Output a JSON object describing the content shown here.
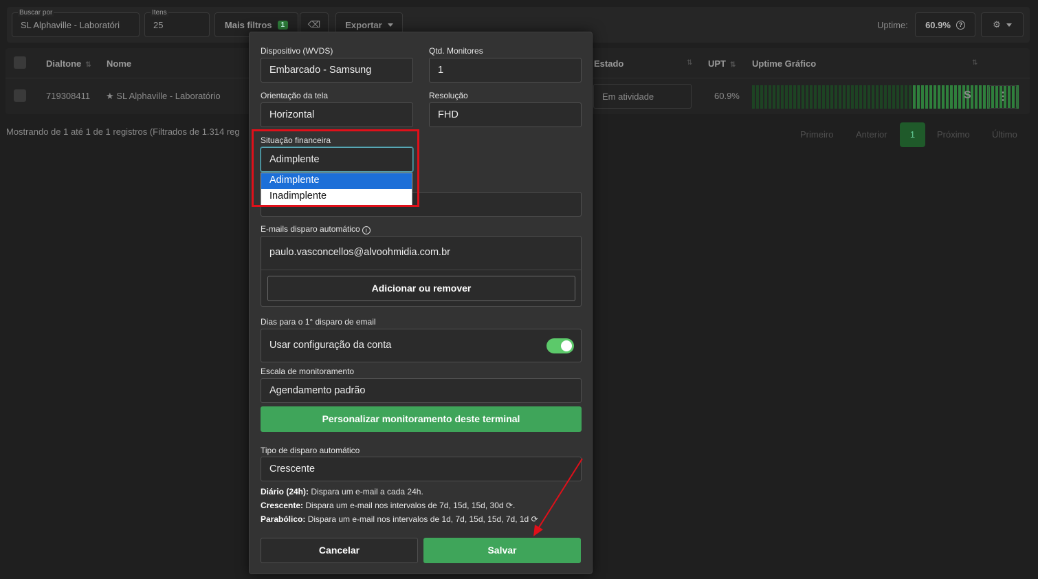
{
  "filters": {
    "search": {
      "label": "Buscar por",
      "value": "SL Alphaville - Laboratóri"
    },
    "items": {
      "label": "Itens",
      "value": "25"
    },
    "more_filters": {
      "label": "Mais filtros",
      "count": "1"
    },
    "export_label": "Exportar",
    "uptime_label": "Uptime:",
    "uptime_value": "60.9%"
  },
  "table": {
    "headers": {
      "dialtone": "Dialtone",
      "nome": "Nome",
      "estado": "Estado",
      "upt": "UPT",
      "uptime_grafico": "Uptime Gráfico"
    },
    "row": {
      "dialtone": "719308411",
      "nome": "SL Alphaville - Laboratório",
      "estado": "Em atividade",
      "upt": "60.9%",
      "status_letter": "S",
      "uptime_bar_pattern": "gggggggggggggggggggggggggggggggggggggggGGGGGGGGGGGGGGGGGGGGGGGGGG"
    }
  },
  "footer": {
    "showing": "Mostrando de 1 até 1 de 1 registros (Filtrados de 1.314 reg",
    "pager": {
      "first": "Primeiro",
      "prev": "Anterior",
      "current": "1",
      "next": "Próximo",
      "last": "Último"
    }
  },
  "modal": {
    "device": {
      "label": "Dispositivo (WVDS)",
      "value": "Embarcado - Samsung"
    },
    "monitors": {
      "label": "Qtd. Monitores",
      "value": "1"
    },
    "orientation": {
      "label": "Orientação da tela",
      "value": "Horizontal"
    },
    "resolution": {
      "label": "Resolução",
      "value": "FHD"
    },
    "finance": {
      "label": "Situação financeira",
      "value": "Adimplente",
      "options": [
        "Adimplente",
        "Inadimplente"
      ]
    },
    "emails": {
      "label": "E-mails disparo automático",
      "value": "paulo.vasconcellos@alvoohmidia.com.br",
      "add_label": "Adicionar ou remover"
    },
    "days": {
      "label": "Dias para o 1° disparo de email",
      "toggle_label": "Usar configuração da conta",
      "toggle_on": true
    },
    "scale": {
      "label": "Escala de monitoramento",
      "value": "Agendamento padrão",
      "customize_label": "Personalizar monitoramento deste terminal"
    },
    "trigger": {
      "label": "Tipo de disparo automático",
      "value": "Crescente"
    },
    "help": [
      {
        "term": "Diário (24h):",
        "text": "Dispara um e-mail a cada 24h."
      },
      {
        "term": "Crescente:",
        "text": "Dispara um e-mail nos intervalos de 7d, 15d, 15d, 30d"
      },
      {
        "term": "Parabólico:",
        "text": "Dispara um e-mail nos intervalos de 1d, 7d, 15d, 15d, 7d, 1d"
      }
    ],
    "cancel_label": "Cancelar",
    "save_label": "Salvar"
  },
  "colors": {
    "accent_green": "#3fa55a",
    "highlight_red": "#e0101a",
    "selected_blue": "#1c6fd8"
  }
}
